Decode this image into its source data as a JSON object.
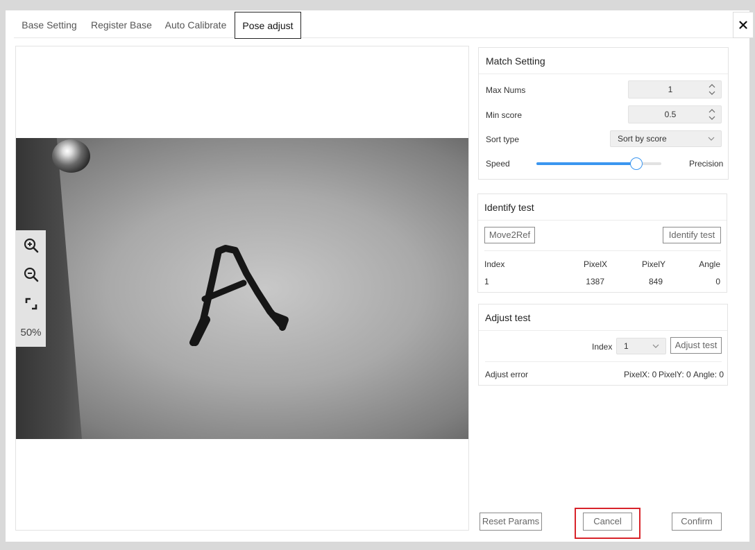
{
  "tabs": [
    {
      "label": "Base Setting",
      "active": false
    },
    {
      "label": "Register Base",
      "active": false
    },
    {
      "label": "Auto Calibrate",
      "active": false
    },
    {
      "label": "Pose adjust",
      "active": true
    }
  ],
  "close_icon": "close-icon",
  "viewer": {
    "zoom_level": "50%",
    "tools": [
      "zoom-in-icon",
      "zoom-out-icon",
      "fit-screen-icon"
    ]
  },
  "match_setting": {
    "title": "Match Setting",
    "max_nums": {
      "label": "Max Nums",
      "value": "1"
    },
    "min_score": {
      "label": "Min score",
      "value": "0.5"
    },
    "sort_type": {
      "label": "Sort type",
      "value": "Sort by score"
    },
    "speed": {
      "label": "Speed",
      "end_label": "Precision",
      "value": 0.8
    }
  },
  "identify_test": {
    "title": "Identify test",
    "move_button": "Move2Ref",
    "test_button": "Identify test",
    "columns": [
      "Index",
      "PixelX",
      "PixelY",
      "Angle"
    ],
    "rows": [
      [
        "1",
        "1387",
        "849",
        "0"
      ]
    ]
  },
  "adjust_test": {
    "title": "Adjust test",
    "index_label": "Index",
    "index_value": "1",
    "test_button": "Adjust test",
    "error_label": "Adjust error",
    "error_values": [
      "PixelX: 0",
      "PixelY: 0",
      "Angle: 0"
    ]
  },
  "footer": {
    "reset": "Reset Params",
    "cancel": "Cancel",
    "confirm": "Confirm"
  },
  "colors": {
    "accent": "#3b96f0",
    "highlight": "#d8232a"
  }
}
